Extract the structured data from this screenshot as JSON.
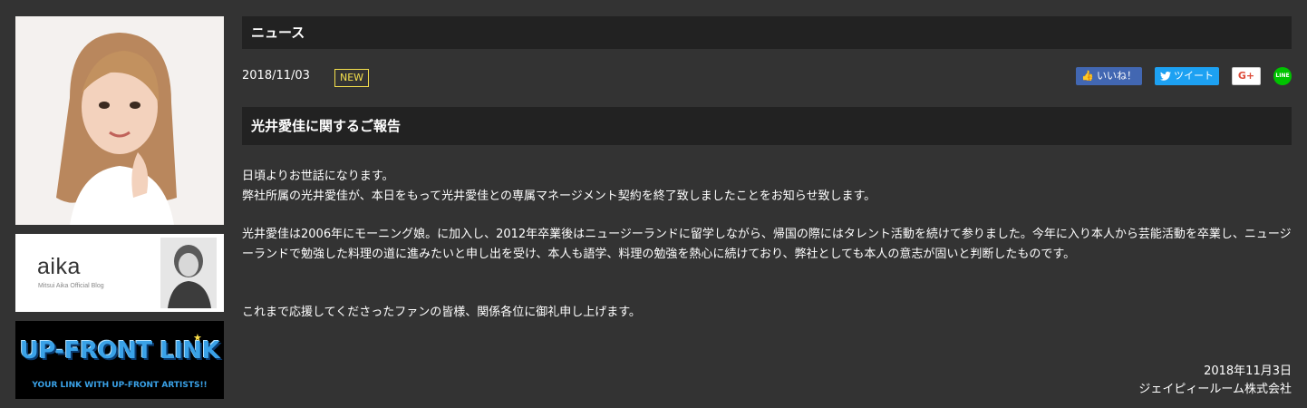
{
  "sidebar": {
    "blog": {
      "title": "aika",
      "subtitle": "Mitsui Aika Official Blog"
    },
    "ufl": {
      "title": "UP-FRONT LINK",
      "subtitle": "YOUR LINK WITH UP-FRONT ARTISTS!!"
    }
  },
  "news": {
    "heading": "ニュース",
    "date": "2018/11/03",
    "badge": "NEW",
    "title": "光井愛佳に関するご報告",
    "paragraphs": [
      "日頃よりお世話になります。",
      "弊社所属の光井愛佳が、本日をもって光井愛佳との専属マネージメント契約を終了致しましたことをお知らせ致します。",
      "光井愛佳は2006年にモーニング娘。に加入し、2012年卒業後はニュージーランドに留学しながら、帰国の際にはタレント活動を続けて参りました。今年に入り本人から芸能活動を卒業し、ニュージーランドで勉強した料理の道に進みたいと申し出を受け、本人も語学、料理の勉強を熱心に続けており、弊社としても本人の意志が固いと判断したものです。",
      "これまで応援してくださったファンの皆様、関係各位に御礼申し上げます。"
    ],
    "sign_date": "2018年11月3日",
    "sign_company": "ジェイピィールーム株式会社"
  },
  "share": {
    "facebook": "いいね！",
    "twitter": "ツイート",
    "gplus": "G+",
    "line": "LINE"
  },
  "colors": {
    "background": "#333333",
    "header": "#222222",
    "badge": "#f4e04d",
    "facebook": "#4267b2",
    "twitter": "#1da1f2",
    "line": "#00c300"
  }
}
